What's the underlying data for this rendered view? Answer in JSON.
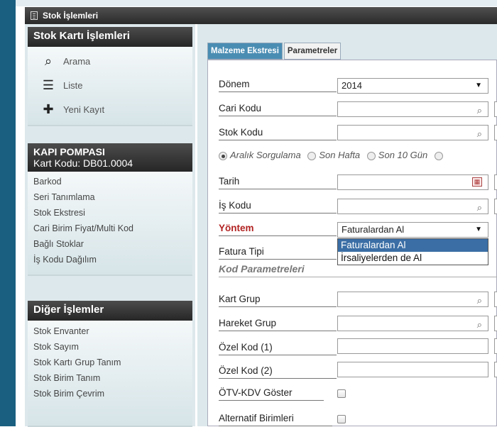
{
  "window": {
    "title": "Stok İşlemleri"
  },
  "sidebar": {
    "stok_karti": {
      "title": "Stok Kartı İşlemleri",
      "items": [
        {
          "label": "Arama",
          "icon": "search-icon"
        },
        {
          "label": "Liste",
          "icon": "list-icon"
        },
        {
          "label": "Yeni Kayıt",
          "icon": "new-record-icon"
        }
      ]
    },
    "kart": {
      "title": "KAPI POMPASI",
      "subtitle": "Kart Kodu: DB01.0004",
      "items": [
        "Barkod",
        "Seri Tanımlama",
        "Stok Ekstresi",
        "Cari Birim Fiyat/Multi Kod",
        "Bağlı Stoklar",
        "İş Kodu Dağılım"
      ]
    },
    "diger": {
      "title": "Diğer İşlemler",
      "items": [
        "Stok Envanter",
        "Stok Sayım",
        "Stok Kartı Grup Tanım",
        "Stok Birim Tanım",
        "Stok Birim Çevrim"
      ]
    }
  },
  "tabs": [
    {
      "label": "Malzeme Ekstresi",
      "active": true
    },
    {
      "label": "Parametreler",
      "active": false
    }
  ],
  "form": {
    "donem": {
      "label": "Dönem",
      "value": "2014"
    },
    "cari_kodu": {
      "label": "Cari Kodu",
      "value": ""
    },
    "stok_kodu": {
      "label": "Stok Kodu",
      "value": ""
    },
    "radios": [
      {
        "label": "Aralık Sorgulama",
        "selected": true
      },
      {
        "label": "Son Hafta",
        "selected": false
      },
      {
        "label": "Son 10 Gün",
        "selected": false
      }
    ],
    "tarih": {
      "label": "Tarih",
      "value": ""
    },
    "is_kodu": {
      "label": "İş Kodu",
      "value": ""
    },
    "yontem": {
      "label": "Yöntem",
      "value": "Faturalardan Al",
      "options": [
        "Faturalardan Al",
        "İrsaliyelerden de Al"
      ]
    },
    "fatura_tipi": {
      "label": "Fatura Tipi"
    },
    "kod_parametreleri": {
      "label": "Kod Parametreleri"
    },
    "kart_grup": {
      "label": "Kart Grup",
      "value": ""
    },
    "hareket_grup": {
      "label": "Hareket Grup",
      "value": ""
    },
    "ozel_kod_1": {
      "label": "Özel Kod (1)",
      "value": ""
    },
    "ozel_kod_2": {
      "label": "Özel Kod (2)",
      "value": ""
    },
    "otv_kdv": {
      "label": "ÖTV-KDV Göster"
    },
    "alternatif": {
      "label": "Alternatif Birimleri"
    }
  },
  "colors": {
    "accent": "#4a8db3",
    "yontem_label": "#b22222",
    "selection": "#3a6ea5"
  }
}
